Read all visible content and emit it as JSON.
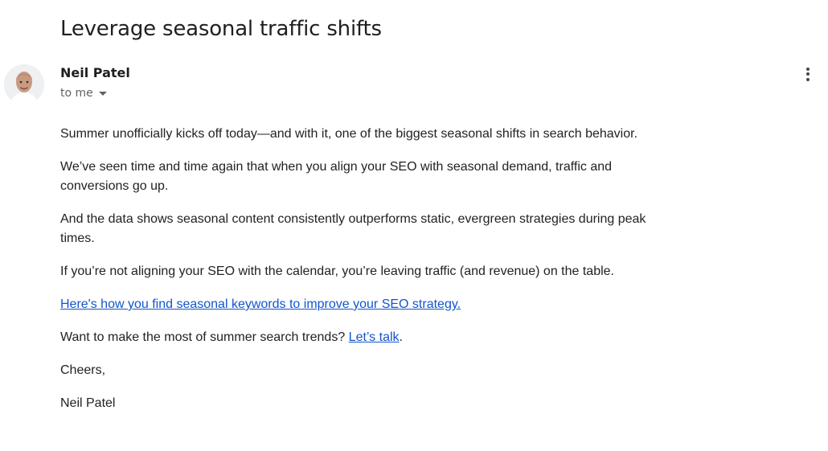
{
  "email": {
    "subject": "Leverage seasonal traffic shifts",
    "sender": {
      "name": "Neil Patel",
      "avatar_icon": "person-avatar-icon"
    },
    "recipient": {
      "label": "to me",
      "dropdown_icon": "chevron-down-icon"
    },
    "actions": {
      "more_options_icon": "more-vertical-icon"
    },
    "body": {
      "paragraphs": [
        "Summer unofficially kicks off today—and with it, one of the biggest seasonal shifts in search behavior.",
        "We’ve seen time and time again that when you align your SEO with seasonal demand, traffic and conversions go up.",
        "And the data shows seasonal content consistently outperforms static, evergreen strategies during peak times.",
        "If you’re not aligning your SEO with the calendar, you’re leaving traffic (and revenue) on the table."
      ],
      "link_text": "Here's how you find seasonal keywords to improve your SEO strategy.",
      "question_text": "Want to make the most of summer search trends?",
      "question_link": "Let’s talk",
      "question_end": ".",
      "closing": "Cheers,",
      "signature": "Neil Patel"
    }
  },
  "colors": {
    "link": "#1155cc",
    "text": "#222222",
    "muted": "#5f6368"
  }
}
